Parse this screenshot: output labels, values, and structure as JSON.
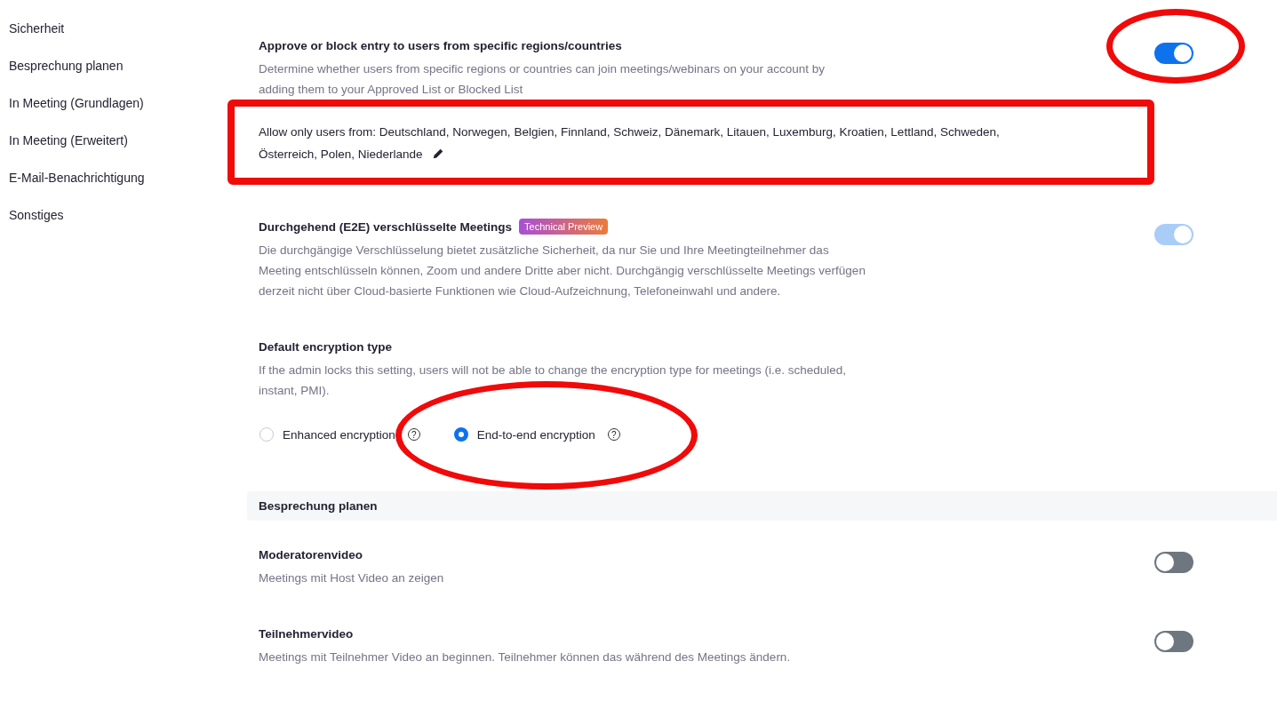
{
  "sidebar": {
    "items": [
      {
        "label": "Sicherheit"
      },
      {
        "label": "Besprechung planen"
      },
      {
        "label": "In Meeting (Grundlagen)"
      },
      {
        "label": "In Meeting (Erweitert)"
      },
      {
        "label": "E-Mail-Benachrichtigung"
      },
      {
        "label": "Sonstiges"
      }
    ]
  },
  "settings": [
    {
      "kind": "toggle",
      "title": "Approve or block entry to users from specific regions/countries",
      "description": [
        "Determine whether users from specific regions or countries can join meetings/webinars on your account by",
        "adding them to your Approved List or Blocked List"
      ],
      "toggle": {
        "on": true,
        "disabled": false,
        "highlighted": true
      },
      "allowed_list": {
        "lines": [
          "Allow only users from: Deutschland, Norwegen, Belgien, Finnland, Schweiz, Dänemark, Litauen, Luxemburg, Kroatien, Lettland, Schweden,",
          "Österreich, Polen, Niederlande"
        ],
        "highlighted": true
      }
    },
    {
      "kind": "toggle",
      "title": "Durchgehend (E2E) verschlüsselte Meetings",
      "badge": "Technical Preview",
      "description": [
        "Die durchgängige Verschlüsselung bietet zusätzliche Sicherheit, da nur Sie und Ihre Meetingteilnehmer das",
        "Meeting entschlüsseln können, Zoom und andere Dritte aber nicht. Durchgängig verschlüsselte Meetings verfügen",
        "derzeit nicht über Cloud-basierte Funktionen wie Cloud-Aufzeichnung, Telefoneinwahl und andere."
      ],
      "toggle": {
        "on": true,
        "disabled": true
      }
    },
    {
      "kind": "radio",
      "title": "Default encryption type",
      "description": [
        "If the admin locks this setting, users will not be able to change the encryption type for meetings (i.e. scheduled,",
        "instant, PMI)."
      ],
      "options": [
        {
          "label": "Enhanced encryption",
          "help": "?",
          "selected": false
        },
        {
          "label": "End-to-end encryption",
          "help": "?",
          "selected": true,
          "highlighted": true
        }
      ]
    },
    {
      "kind": "section",
      "title": "Besprechung planen"
    },
    {
      "kind": "toggle",
      "title": "Moderatorenvideo",
      "description": [
        "Meetings mit Host Video an zeigen"
      ],
      "toggle": {
        "on": false,
        "disabled": false
      }
    },
    {
      "kind": "toggle",
      "title": "Teilnehmervideo",
      "description": [
        "Meetings mit Teilnehmer Video an beginnen. Teilnehmer können das während des Meetings ändern."
      ],
      "toggle": {
        "on": false,
        "disabled": false
      }
    }
  ]
}
